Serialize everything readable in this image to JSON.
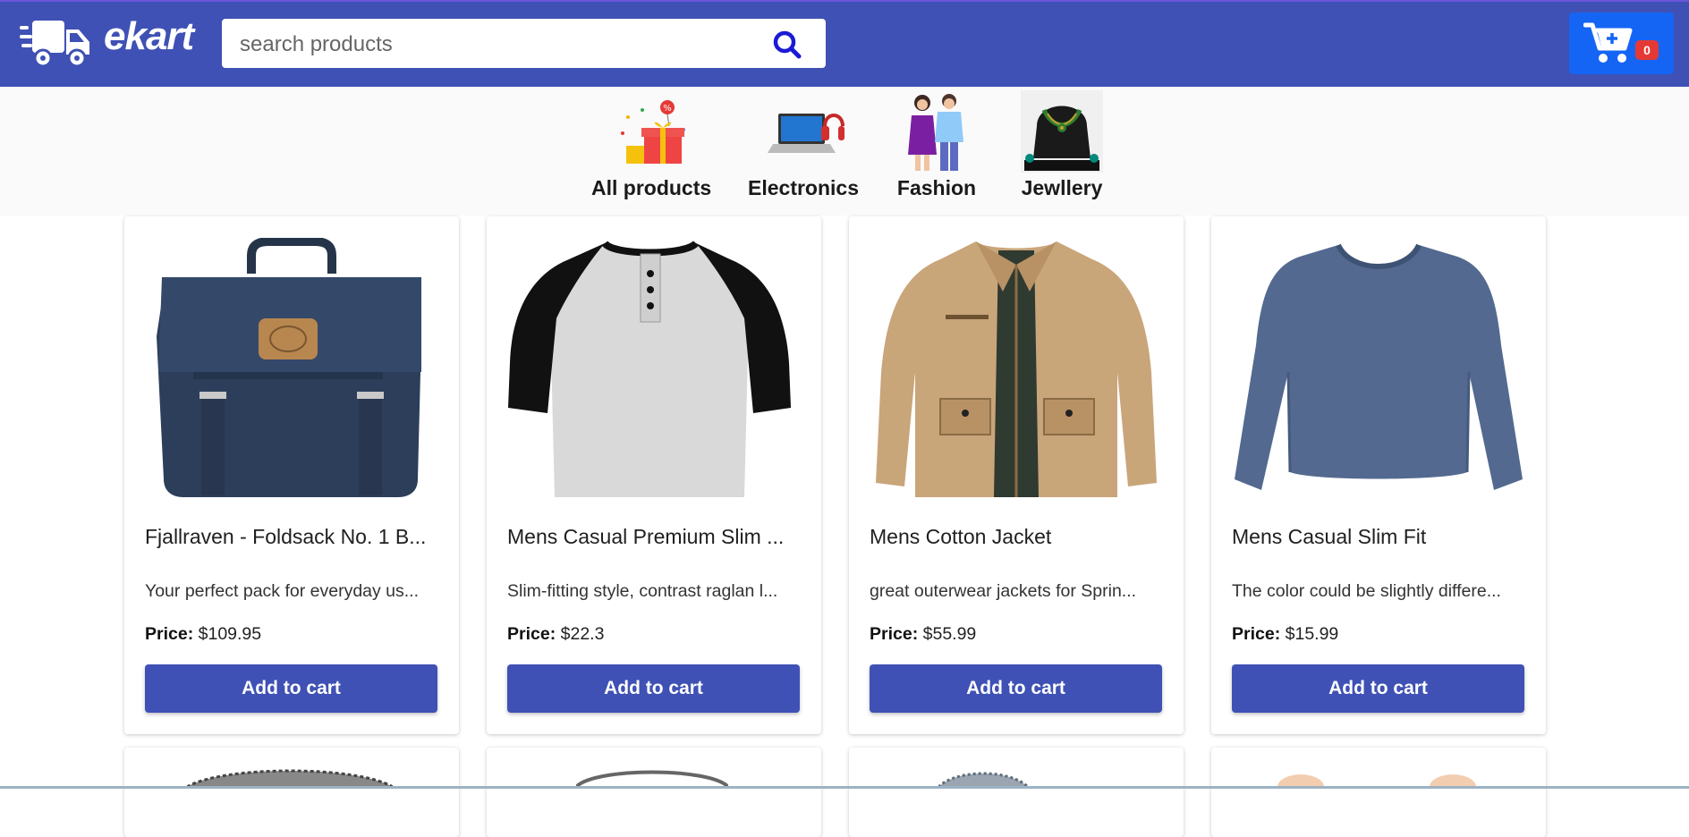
{
  "header": {
    "logo_text": "ekart",
    "search_placeholder": "search products",
    "cart_count": "0"
  },
  "categories": [
    {
      "label": "All products"
    },
    {
      "label": "Electronics"
    },
    {
      "label": "Fashion"
    },
    {
      "label": "Jewllery"
    }
  ],
  "products": [
    {
      "title": "Fjallraven - Foldsack No. 1 B...",
      "description": "Your perfect pack for everyday us...",
      "price_label": "Price:",
      "price": "$109.95",
      "button": "Add to cart"
    },
    {
      "title": "Mens Casual Premium Slim ...",
      "description": "Slim-fitting style, contrast raglan l...",
      "price_label": "Price:",
      "price": "$22.3",
      "button": "Add to cart"
    },
    {
      "title": "Mens Cotton Jacket",
      "description": "great outerwear jackets for Sprin...",
      "price_label": "Price:",
      "price": "$55.99",
      "button": "Add to cart"
    },
    {
      "title": "Mens Casual Slim Fit",
      "description": "The color could be slightly differe...",
      "price_label": "Price:",
      "price": "$15.99",
      "button": "Add to cart"
    }
  ],
  "colors": {
    "primary": "#3f51b5",
    "cart_button": "#1565f5",
    "badge": "#e53935"
  }
}
